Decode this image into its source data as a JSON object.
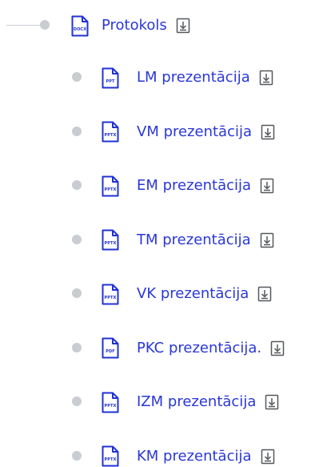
{
  "tree": {
    "root": {
      "label": "Protokols",
      "file_type": "DOCX"
    },
    "children": [
      {
        "label": "LM prezentācija",
        "file_type": "PPT"
      },
      {
        "label": "VM prezentācija",
        "file_type": "PPTX"
      },
      {
        "label": "EM prezentācija",
        "file_type": "PPTX"
      },
      {
        "label": "TM prezentācija",
        "file_type": "PPTX"
      },
      {
        "label": "VK prezentācija",
        "file_type": "PPTX"
      },
      {
        "label": "PKC prezentācija.",
        "file_type": "PDF"
      },
      {
        "label": "IZM prezentācija",
        "file_type": "PPTX"
      },
      {
        "label": "KM prezentācija",
        "file_type": "PPTX"
      }
    ]
  },
  "colors": {
    "link": "#2a37d8",
    "icon_stroke": "#2132d6",
    "bullet": "#c9ccd1",
    "download_icon": "#55585c"
  },
  "icons": {
    "file": "document-file-icon",
    "download": "download-icon",
    "bullet": "tree-bullet"
  }
}
